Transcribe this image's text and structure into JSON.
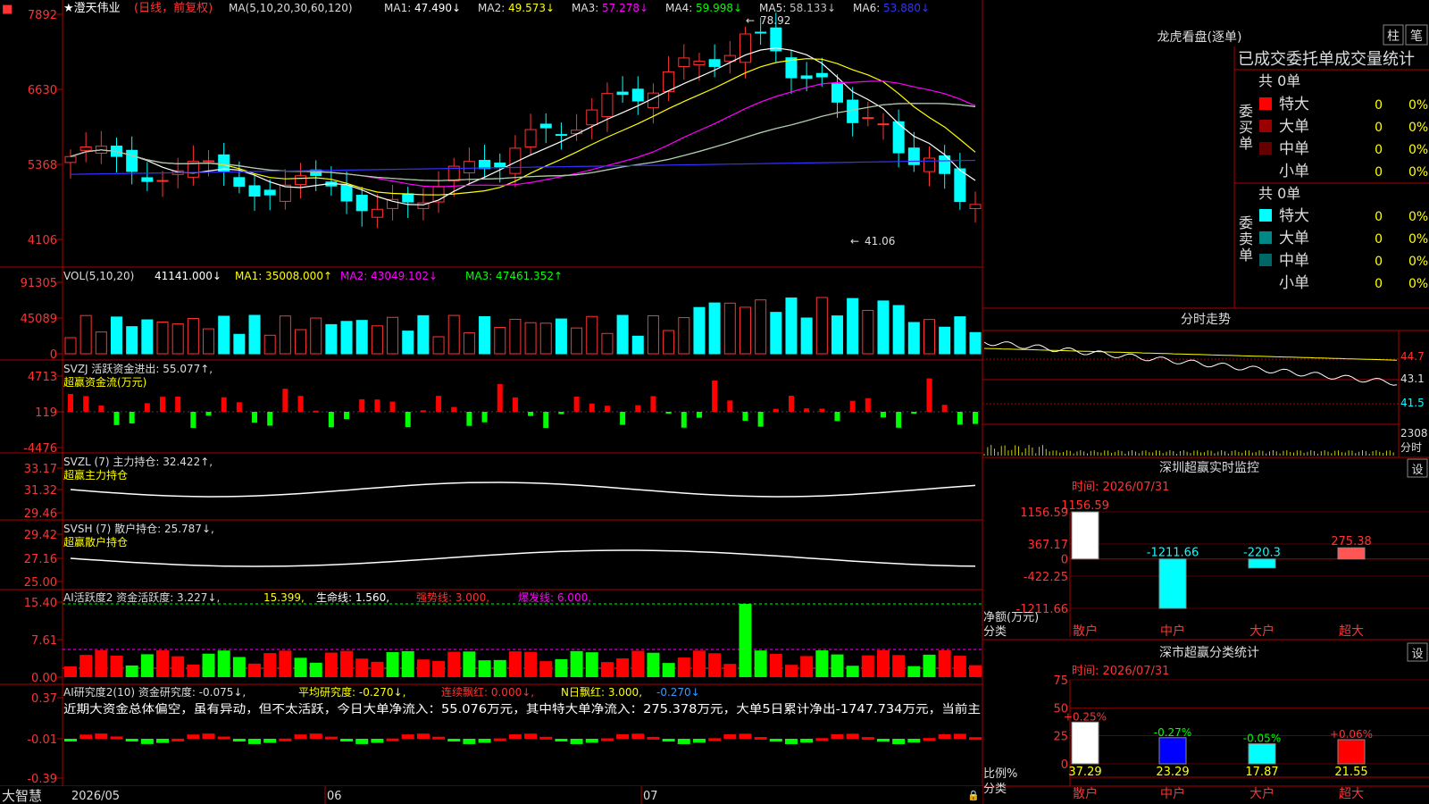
{
  "app": {
    "brand": "大智慧"
  },
  "main_chart": {
    "stock_title": "★澄天伟业",
    "period_note": "(日线，前复权)",
    "ma_prefix": "MA(5,10,20,30,60,120)",
    "ma_values": [
      {
        "label": "MA1:",
        "value": "47.490↓",
        "color": "#ffffff"
      },
      {
        "label": "MA2:",
        "value": "49.573↓",
        "color": "#ffff00"
      },
      {
        "label": "MA3:",
        "value": "57.278↓",
        "color": "#ff00ff"
      },
      {
        "label": "MA4:",
        "value": "59.998↓",
        "color": "#00ff00"
      },
      {
        "label": "MA5:",
        "value": "58.133↓",
        "color": "#c0c0c0"
      },
      {
        "label": "MA6:",
        "value": "53.880↓",
        "color": "#3333ff"
      }
    ],
    "price_ticks": [
      "7892",
      "6630",
      "5368",
      "4106"
    ],
    "high_label": "78.92",
    "low_label": "41.06"
  },
  "volume_panel": {
    "title": "VOL(5,10,20)",
    "value": "41141.000↓",
    "ma1": "MA1: 35008.000↑",
    "ma2": "MA2: 43049.102↓",
    "ma3": "MA3: 47461.352↑",
    "ticks": [
      "91305",
      "45089",
      "0"
    ]
  },
  "svzj_panel": {
    "title": "SVZJ  活跃资金进出: 55.077↑,",
    "subtitle": "超赢资金流(万元)",
    "ticks": [
      "4713",
      "119",
      "-4476"
    ]
  },
  "svzl_panel": {
    "title": "SVZL (7) 主力持仓: 32.422↑,",
    "subtitle": "超赢主力持仓",
    "ticks": [
      "33.17",
      "31.32",
      "29.46"
    ]
  },
  "svsh_panel": {
    "title": "SVSH (7) 散户持仓: 25.787↓,",
    "subtitle": "超赢散户持仓",
    "ticks": [
      "29.42",
      "27.16",
      "25.00"
    ]
  },
  "ai_active_panel": {
    "title_a": "AI活跃度2 资金活跃度: 3.227↓,",
    "title_b": "15.399,",
    "title_c": "生命线: 1.560,",
    "title_d": "强势线: 3.000,",
    "title_e": "爆发线: 6.000,",
    "ticks": [
      "15.40",
      "7.61",
      "0.00"
    ]
  },
  "ai_research_panel": {
    "title_a": "AI研究度2(10) 资金研究度: -0.075↓,",
    "title_b": "平均研究度: -0.270↓,",
    "title_c": "连续飘红: 0.000↓,",
    "title_d": "N日飘红: 3.000,",
    "title_e": "-0.270↓",
    "commentary": "近期大资金总体偏空，虽有异动，但不太活跃，今日大单净流入：55.076万元，其中特大单净流入：275.378万元，大单5日累计净出-1747.734万元，当前主",
    "ticks": [
      "0.37",
      "-0.01",
      "-0.39"
    ]
  },
  "date_axis": [
    "2026/05",
    "06",
    "07"
  ],
  "longhu": {
    "title": "龙虎看盘(逐单)",
    "tab_bar": "柱",
    "tab_count": "笔",
    "subtitle": "已成交委托单成交量统计",
    "buy_side": "委买单",
    "sell_side": "委卖单",
    "buy_total": "共 0单",
    "sell_total": "共 0单",
    "buy_rows": [
      {
        "label": "特大",
        "count": "0",
        "pct": "0%",
        "color": "#ff0000"
      },
      {
        "label": "大单",
        "count": "0",
        "pct": "0%",
        "color": "#990000"
      },
      {
        "label": "中单",
        "count": "0",
        "pct": "0%",
        "color": "#660000"
      },
      {
        "label": "小单",
        "count": "0",
        "pct": "0%",
        "color": ""
      }
    ],
    "sell_rows": [
      {
        "label": "特大",
        "count": "0",
        "pct": "0%",
        "color": "#00ffff"
      },
      {
        "label": "大单",
        "count": "0",
        "pct": "0%",
        "color": "#008888"
      },
      {
        "label": "中单",
        "count": "0",
        "pct": "0%",
        "color": "#006666"
      },
      {
        "label": "小单",
        "count": "0",
        "pct": "0%",
        "color": ""
      }
    ]
  },
  "intraday": {
    "title": "分时走势",
    "prices": [
      "44.7",
      "43.1",
      "41.5"
    ],
    "volume_label": "2308",
    "volume_unit": "分时"
  },
  "sz_monitor": {
    "title": "深圳超赢实时监控",
    "settings": "设",
    "time": "时间: 2026/07/31",
    "ylabel": "净额(万元)",
    "xlabel": "分类",
    "ticks": [
      "1156.59",
      "367.17",
      "0",
      "-422.25",
      "-1211.66"
    ],
    "categories": [
      "散户",
      "中户",
      "大户",
      "超大"
    ],
    "values": [
      1156.59,
      -1211.66,
      -220.3,
      275.38
    ],
    "value_labels": [
      "1156.59",
      "-1211.66",
      "-220.3",
      "275.38"
    ]
  },
  "sz_stats": {
    "title": "深市超赢分类统计",
    "settings": "设",
    "time": "时间: 2026/07/31",
    "ylabel": "比例%",
    "xlabel": "分类",
    "ticks": [
      "75",
      "50",
      "25",
      "0"
    ],
    "categories": [
      "散户",
      "中户",
      "大户",
      "超大"
    ],
    "values": [
      37.29,
      23.29,
      17.87,
      21.55
    ],
    "value_labels": [
      "37.29",
      "23.29",
      "17.87",
      "21.55"
    ],
    "changes": [
      "+0.25%",
      "-0.27%",
      "-0.05%",
      "+0.06%"
    ],
    "colors": [
      "#ffffff",
      "#0000ff",
      "#00ffff",
      "#ff0000"
    ]
  },
  "chart_data": [
    {
      "type": "bar",
      "title": "深圳超赢实时监控",
      "xlabel": "分类",
      "ylabel": "净额(万元)",
      "categories": [
        "散户",
        "中户",
        "大户",
        "超大"
      ],
      "values": [
        1156.59,
        -1211.66,
        -220.3,
        275.38
      ],
      "ylim": [
        -1211.66,
        1156.59
      ]
    },
    {
      "type": "bar",
      "title": "深市超赢分类统计",
      "xlabel": "分类",
      "ylabel": "比例%",
      "categories": [
        "散户",
        "中户",
        "大户",
        "超大"
      ],
      "values": [
        37.29,
        23.29,
        17.87,
        21.55
      ],
      "ylim": [
        0,
        75
      ]
    }
  ]
}
